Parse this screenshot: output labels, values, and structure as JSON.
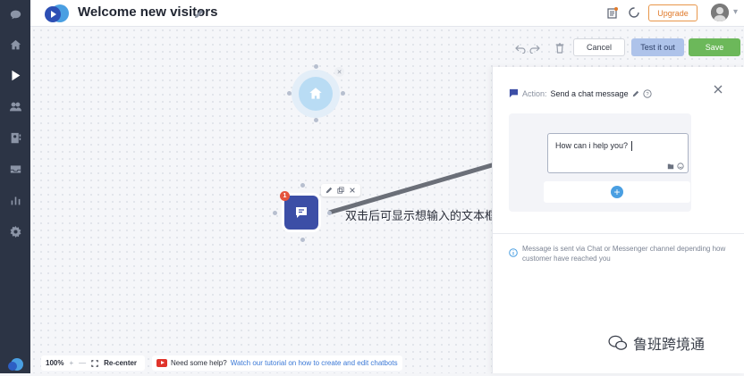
{
  "app": {
    "title": "Welcome new visitors",
    "upgrade_label": "Upgrade"
  },
  "nav": {
    "items": [
      {
        "icon": "chat-icon"
      },
      {
        "icon": "home-icon"
      },
      {
        "icon": "play-icon",
        "active": true
      },
      {
        "icon": "users-icon"
      },
      {
        "icon": "contacts-icon"
      },
      {
        "icon": "inbox-icon"
      },
      {
        "icon": "stats-icon"
      },
      {
        "icon": "settings-icon"
      }
    ]
  },
  "toolbar": {
    "cancel_label": "Cancel",
    "test_label": "Test it out",
    "save_label": "Save"
  },
  "canvas": {
    "action_badge": "1",
    "annotation": "双击后可显示想输入的文本框"
  },
  "panel": {
    "action_label": "Action:",
    "action_name": "Send a chat message",
    "message_text": "How can i help you?",
    "info_text": "Message is sent via Chat or Messenger channel depending how customer have reached you"
  },
  "bottom": {
    "zoom_level": "100%",
    "zoom_in": "+",
    "zoom_out": "—",
    "recenter_label": "Re-center",
    "help_label": "Need some help?",
    "help_link": "Watch our tutorial on how to create and edit chatbots"
  },
  "watermark": {
    "text": "鲁班跨境通"
  },
  "colors": {
    "nav_bg": "#2c3445",
    "action_node": "#3c4ea6",
    "save_green": "#6cb85a",
    "test_blue": "#aec3ea",
    "upgrade_orange": "#e07a2b",
    "link_blue": "#3a78d6"
  }
}
